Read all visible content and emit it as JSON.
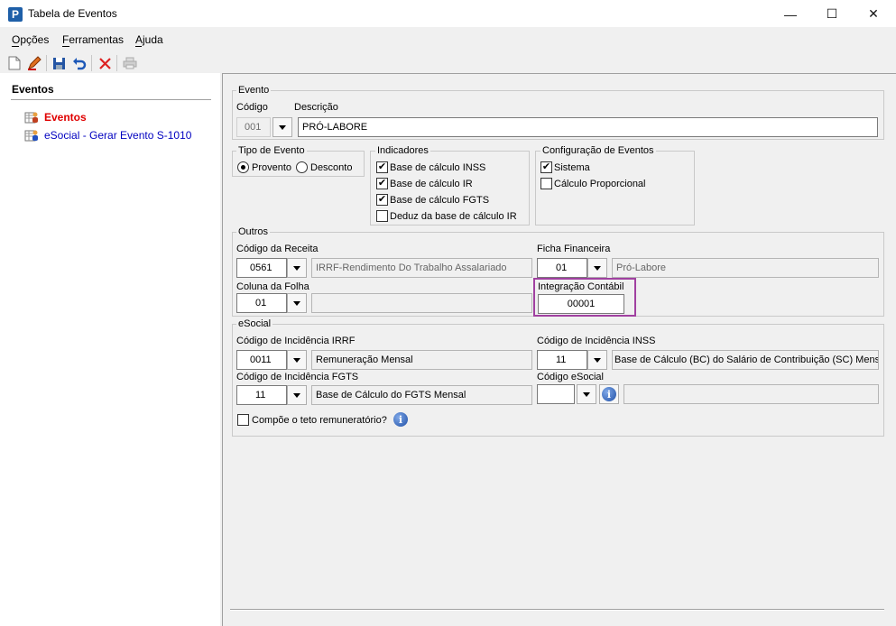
{
  "window": {
    "title": "Tabela de Eventos",
    "icon_letter": "P",
    "minimize": "—",
    "maximize": "☐",
    "close": "✕"
  },
  "menu": {
    "opcoes": "Opções",
    "ferramentas": "Ferramentas",
    "ajuda": "Ajuda"
  },
  "sidebar": {
    "title": "Eventos",
    "items": [
      {
        "label": "Eventos",
        "color": "#e00000"
      },
      {
        "label": "eSocial - Gerar Evento S-1010",
        "color": "#0000c0"
      }
    ]
  },
  "evento": {
    "group": "Evento",
    "codigo_label": "Código",
    "codigo_value": "001",
    "descricao_label": "Descrição",
    "descricao_value": "PRÓ-LABORE"
  },
  "tipo": {
    "group": "Tipo de Evento",
    "provento": "Provento",
    "desconto": "Desconto",
    "selected": "Provento"
  },
  "indicadores": {
    "group": "Indicadores",
    "items": [
      {
        "label": "Base de cálculo INSS",
        "checked": true
      },
      {
        "label": "Base de cálculo IR",
        "checked": true
      },
      {
        "label": "Base de cálculo FGTS",
        "checked": true
      },
      {
        "label": "Deduz da base de cálculo IR",
        "checked": false
      }
    ]
  },
  "config": {
    "group": "Configuração de Eventos",
    "items": [
      {
        "label": "Sistema",
        "checked": true
      },
      {
        "label": "Cálculo Proporcional",
        "checked": false
      }
    ]
  },
  "outros": {
    "group": "Outros",
    "receita_label": "Código da Receita",
    "receita_code": "0561",
    "receita_desc": "IRRF-Rendimento Do Trabalho Assalariado",
    "ficha_label": "Ficha Financeira",
    "ficha_code": "01",
    "ficha_desc": "Pró-Labore",
    "coluna_label": "Coluna da Folha",
    "coluna_code": "01",
    "coluna_desc": "",
    "integracao_label": "Integração Contábil",
    "integracao_value": "00001",
    "highlight_color": "#a040a0"
  },
  "esocial": {
    "group": "eSocial",
    "irrf_label": "Código de Incidência IRRF",
    "irrf_code": "0011",
    "irrf_desc": "Remuneração Mensal",
    "inss_label": "Código de Incidência INSS",
    "inss_code": "11",
    "inss_desc": "Base de Cálculo (BC) do Salário de Contribuição (SC) Mensal",
    "fgts_label": "Código de Incidência FGTS",
    "fgts_code": "11",
    "fgts_desc": "Base de Cálculo do FGTS Mensal",
    "codigo_label": "Código eSocial",
    "codigo_value": "",
    "compoe_label": "Compõe o teto remuneratório?",
    "compoe_checked": false
  },
  "icons": {
    "info": "i"
  }
}
